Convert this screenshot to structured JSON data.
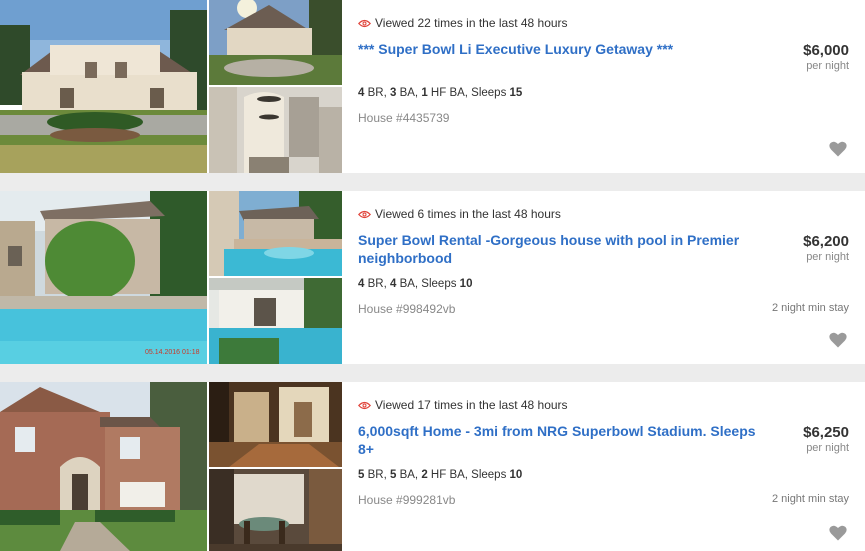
{
  "listings": [
    {
      "viewed": "Viewed 22 times in the last 48 hours",
      "title": "*** Super Bowl Li Executive Luxury Getaway ***",
      "specs": [
        {
          "num": "4",
          "unit": " BR, "
        },
        {
          "num": "3",
          "unit": " BA, "
        },
        {
          "num": "1",
          "unit": " HF BA, Sleeps "
        },
        {
          "num": "15",
          "unit": ""
        }
      ],
      "house_id": "House #4435739",
      "min_stay": "",
      "price": "$6,000",
      "per": "per night"
    },
    {
      "viewed": "Viewed 6 times in the last 48 hours",
      "title": "Super Bowl Rental -Gorgeous house with pool in Premier neighborbood",
      "specs": [
        {
          "num": "4",
          "unit": " BR, "
        },
        {
          "num": "4",
          "unit": " BA, Sleeps "
        },
        {
          "num": "10",
          "unit": ""
        }
      ],
      "house_id": "House #998492vb",
      "min_stay": "2 night min stay",
      "price": "$6,200",
      "per": "per night"
    },
    {
      "viewed": "Viewed 17 times in the last 48 hours",
      "title": "6,000sqft Home - 3mi from NRG Superbowl Stadium. Sleeps 8+",
      "specs": [
        {
          "num": "5",
          "unit": " BR, "
        },
        {
          "num": "5",
          "unit": " BA, "
        },
        {
          "num": "2",
          "unit": " HF BA, Sleeps "
        },
        {
          "num": "10",
          "unit": ""
        }
      ],
      "house_id": "House #999281vb",
      "min_stay": "2 night min stay",
      "price": "$6,250",
      "per": "per night"
    }
  ],
  "photo_stamp": "05.14.2016 01:18",
  "colors": {
    "title_link": "#2f6fc6",
    "eye_icon": "#e0433a",
    "heart_icon": "#9a9a9a"
  }
}
